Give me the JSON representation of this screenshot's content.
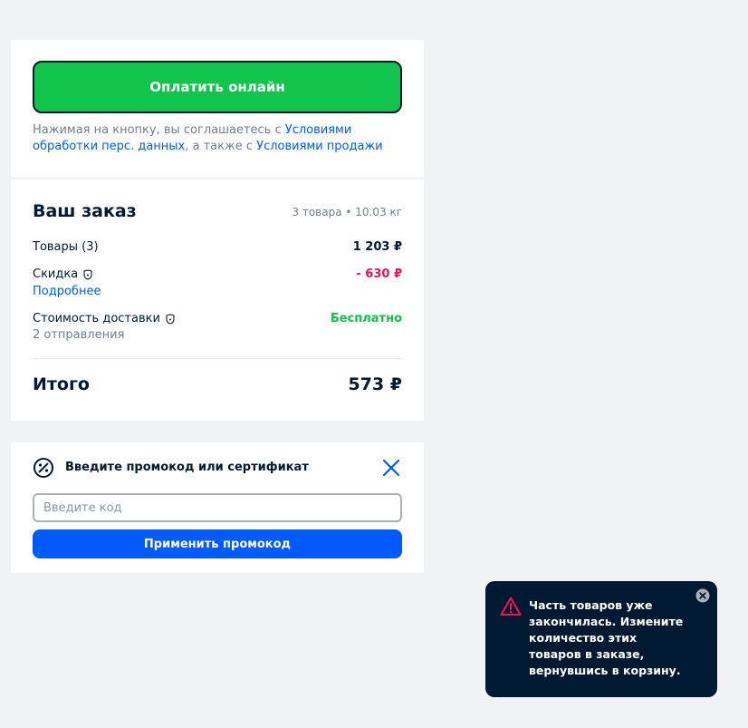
{
  "checkout": {
    "pay_button_label": "Оплатить онлайн",
    "consent": {
      "prefix": "Нажимая на кнопку, вы соглашаетесь с ",
      "link1": "Условиями обработки перс. данных",
      "middle": ", а также с ",
      "link2": "Условиями продажи"
    }
  },
  "order": {
    "title": "Ваш заказ",
    "meta": "3 товара • 10.03 кг",
    "items_label": "Товары (3)",
    "items_value": "1 203 ₽",
    "discount_label": "Скидка",
    "discount_value": "- 630 ₽",
    "discount_link": "Подробнее",
    "delivery_label": "Стоимость доставки",
    "delivery_value": "Бесплатно",
    "delivery_sub": "2 отправления",
    "total_label": "Итого",
    "total_value": "573 ₽"
  },
  "promo": {
    "title": "Введите промокод или сертификат",
    "input_placeholder": "Введите код",
    "apply_label": "Применить промокод"
  },
  "toast": {
    "message": "Часть товаров уже закончилась. Измените количество этих товаров в заказе, вернувшись в корзину."
  },
  "colors": {
    "brand_blue": "#005bff",
    "pay_green": "#10c44c",
    "discount_red": "#f91155",
    "free_green": "#10c44c",
    "toast_bg": "#001a34",
    "warning_pink": "#f91155"
  },
  "icons": [
    "percent-icon",
    "close-icon",
    "info-shield-icon",
    "warning-icon",
    "close-circle-icon"
  ]
}
